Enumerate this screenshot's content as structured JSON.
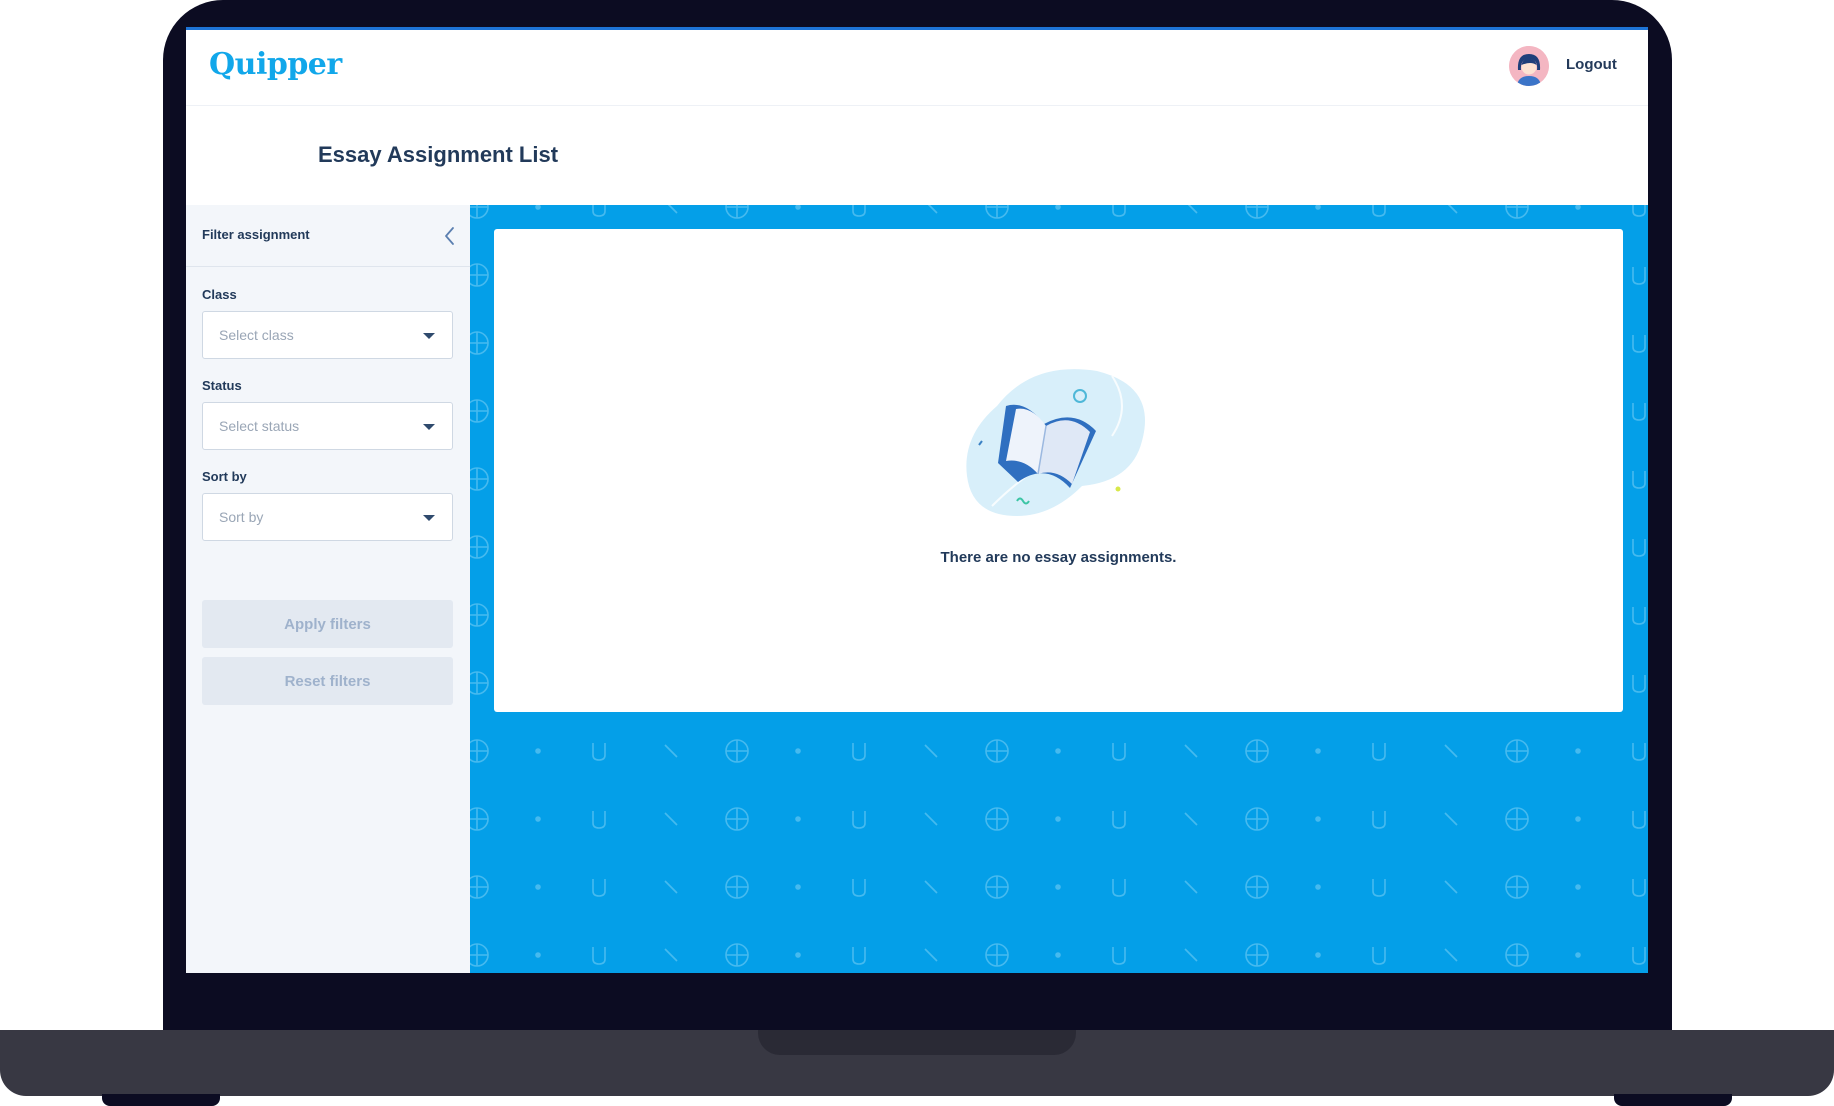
{
  "header": {
    "logo": "Quipper",
    "logout_label": "Logout"
  },
  "page": {
    "title": "Essay Assignment List"
  },
  "sidebar": {
    "title": "Filter assignment",
    "class": {
      "label": "Class",
      "placeholder": "Select class"
    },
    "status": {
      "label": "Status",
      "placeholder": "Select status"
    },
    "sort": {
      "label": "Sort by",
      "placeholder": "Sort by"
    },
    "apply_label": "Apply filters",
    "reset_label": "Reset filters"
  },
  "main": {
    "empty_message": "There are no essay assignments."
  },
  "colors": {
    "brand": "#11a7ea",
    "background": "#049fe8",
    "text": "#223a5a",
    "disabled_button": "#e3e9f1"
  }
}
